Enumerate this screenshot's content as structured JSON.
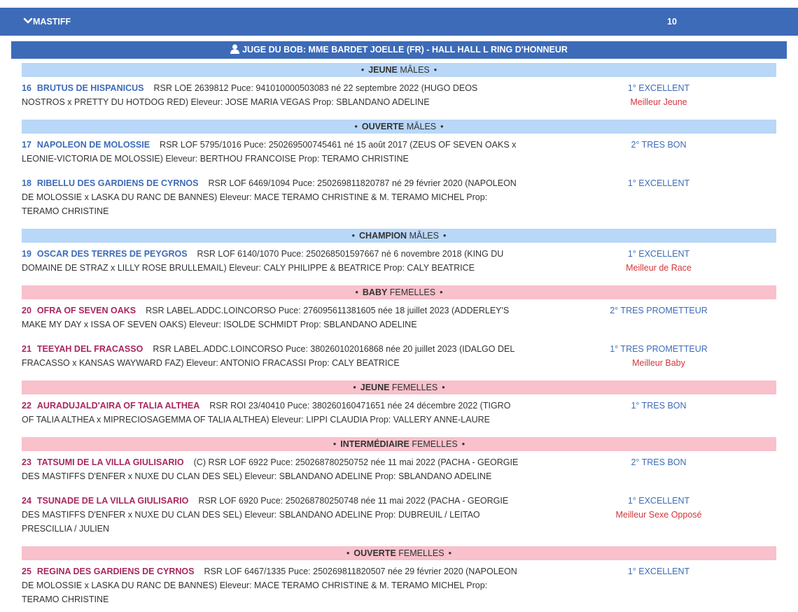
{
  "breed": {
    "name": "MASTIFF",
    "count": "10"
  },
  "judge": {
    "text": "JUGE DU BOB: MME BARDET JOELLE (FR) - HALL HALL L RING D'HONNEUR"
  },
  "classes": [
    {
      "class_name": "JEUNE",
      "sex": "MÂLES",
      "kind": "male"
    },
    {
      "class_name": "OUVERTE",
      "sex": "MÂLES",
      "kind": "male"
    },
    {
      "class_name": "CHAMPION",
      "sex": "MÂLES",
      "kind": "male"
    },
    {
      "class_name": "BABY",
      "sex": "FEMELLES",
      "kind": "female"
    },
    {
      "class_name": "JEUNE",
      "sex": "FEMELLES",
      "kind": "female"
    },
    {
      "class_name": "INTERMÉDIAIRE",
      "sex": "FEMELLES",
      "kind": "female"
    },
    {
      "class_name": "OUVERTE",
      "sex": "FEMELLES",
      "kind": "female"
    }
  ],
  "entries": [
    {
      "number": "16",
      "name": "BRUTUS DE HISPANICUS",
      "details": "RSR LOE 2639812 Puce: 941010000503083 né 22 septembre 2022 (HUGO DEOS NOSTROS x PRETTY DU HOTDOG RED) Eleveur: JOSE MARIA VEGAS Prop: SBLANDANO ADELINE",
      "result": "1° EXCELLENT",
      "award": "Meilleur Jeune"
    },
    {
      "number": "17",
      "name": "NAPOLEON DE MOLOSSIE",
      "details": "RSR LOF 5795/1016 Puce: 250269500745461 né 15 août 2017 (ZEUS OF SEVEN OAKS x LEONIE-VICTORIA DE MOLOSSIE) Eleveur: BERTHOU FRANCOISE Prop: TERAMO CHRISTINE",
      "result": "2° TRES BON",
      "award": ""
    },
    {
      "number": "18",
      "name": "RIBELLU DES GARDIENS DE CYRNOS",
      "details": "RSR LOF 6469/1094 Puce: 250269811820787 né 29 février 2020 (NAPOLEON DE MOLOSSIE x LASKA DU RANC DE BANNES) Eleveur: MACE TERAMO CHRISTINE & M. TERAMO MICHEL Prop: TERAMO CHRISTINE",
      "result": "1° EXCELLENT",
      "award": ""
    },
    {
      "number": "19",
      "name": "OSCAR DES TERRES DE PEYGROS",
      "details": "RSR LOF 6140/1070 Puce: 250268501597667 né 6 novembre 2018 (KING DU DOMAINE DE STRAZ x LILLY ROSE BRULLEMAIL) Eleveur: CALY PHILIPPE & BEATRICE Prop: CALY BEATRICE",
      "result": "1° EXCELLENT",
      "award": "Meilleur de Race"
    },
    {
      "number": "20",
      "name": "OFRA OF SEVEN OAKS",
      "details": "RSR LABEL.ADDC.LOINCORSO Puce: 276095611381605 née 18 juillet 2023 (ADDERLEY'S MAKE MY DAY x ISSA OF SEVEN OAKS) Eleveur: ISOLDE SCHMIDT Prop: SBLANDANO ADELINE",
      "result": "2° TRES PROMETTEUR",
      "award": ""
    },
    {
      "number": "21",
      "name": "TEEYAH DEL FRACASSO",
      "details": "RSR LABEL.ADDC.LOINCORSO Puce: 380260102016868 née 20 juillet 2023 (IDALGO DEL FRACASSO x KANSAS WAYWARD FAZ) Eleveur: ANTONIO FRACASSI Prop: CALY BEATRICE",
      "result": "1° TRES PROMETTEUR",
      "award": "Meilleur Baby"
    },
    {
      "number": "22",
      "name": "AURADUJALD'AIRA OF TALIA ALTHEA",
      "details": "RSR ROI 23/40410 Puce: 380260160471651 née 24 décembre 2022 (TIGRO OF TALIA ALTHEA x MIPRECIOSAGEMMA OF TALIA ALTHEA) Eleveur: LIPPI CLAUDIA Prop: VALLERY ANNE-LAURE",
      "result": "1° TRES BON",
      "award": ""
    },
    {
      "number": "23",
      "name": "TATSUMI DE LA VILLA GIULISARIO",
      "details": "(C) RSR LOF 6922 Puce: 250268780250752 née 11 mai 2022 (PACHA - GEORGIE DES MASTIFFS D'ENFER x NUXE DU CLAN DES SEL) Eleveur: SBLANDANO ADELINE Prop: SBLANDANO ADELINE",
      "result": "2° TRES BON",
      "award": ""
    },
    {
      "number": "24",
      "name": "TSUNADE DE LA VILLA GIULISARIO",
      "details": "RSR LOF 6920 Puce: 250268780250748 née 11 mai 2022 (PACHA - GEORGIE DES MASTIFFS D'ENFER x NUXE DU CLAN DES SEL) Eleveur: SBLANDANO ADELINE Prop: DUBREUIL / LEITAO PRESCILLIA / JULIEN",
      "result": "1° EXCELLENT",
      "award": "Meilleur Sexe Opposé"
    },
    {
      "number": "25",
      "name": "REGINA DES GARDIENS DE CYRNOS",
      "details": "RSR LOF 6467/1335 Puce: 250269811820507 née 29 février 2020 (NAPOLEON DE MOLOSSIE x LASKA DU RANC DE BANNES) Eleveur: MACE TERAMO CHRISTINE & M. TERAMO MICHEL Prop: TERAMO CHRISTINE",
      "result": "1° EXCELLENT",
      "award": ""
    }
  ]
}
